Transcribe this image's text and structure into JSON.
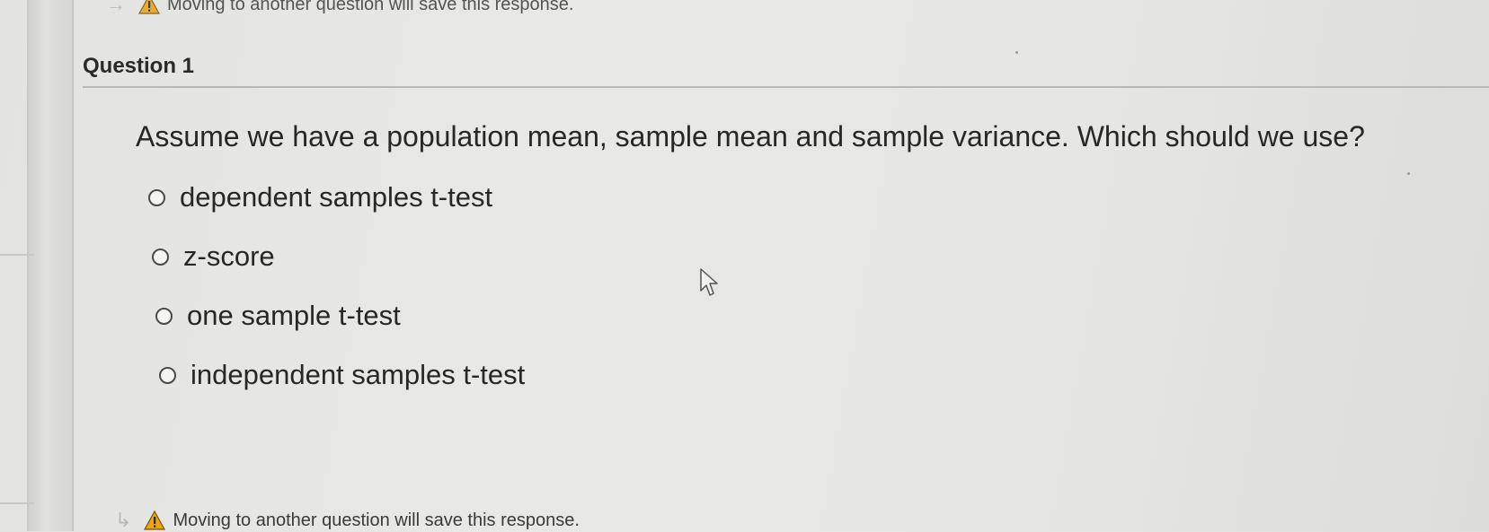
{
  "notices": {
    "top_text": "Moving to another question will save this response.",
    "bottom_text": "Moving to another question will save this response.",
    "arrow_glyph": "→",
    "arrow_glyph_bottom": "↳",
    "warning_color": "#e8a317"
  },
  "question": {
    "title": "Question 1",
    "prompt": "Assume we have a population mean, sample mean and sample variance.  Which should we use?",
    "options": [
      {
        "label": "dependent samples t-test",
        "selected": false
      },
      {
        "label": "z-score",
        "selected": false
      },
      {
        "label": "one sample t-test",
        "selected": false
      },
      {
        "label": "independent samples t-test",
        "selected": false
      }
    ]
  },
  "icons": {
    "warning": "warning-triangle-icon",
    "radio": "radio-empty-icon",
    "cursor": "mouse-pointer-icon"
  }
}
